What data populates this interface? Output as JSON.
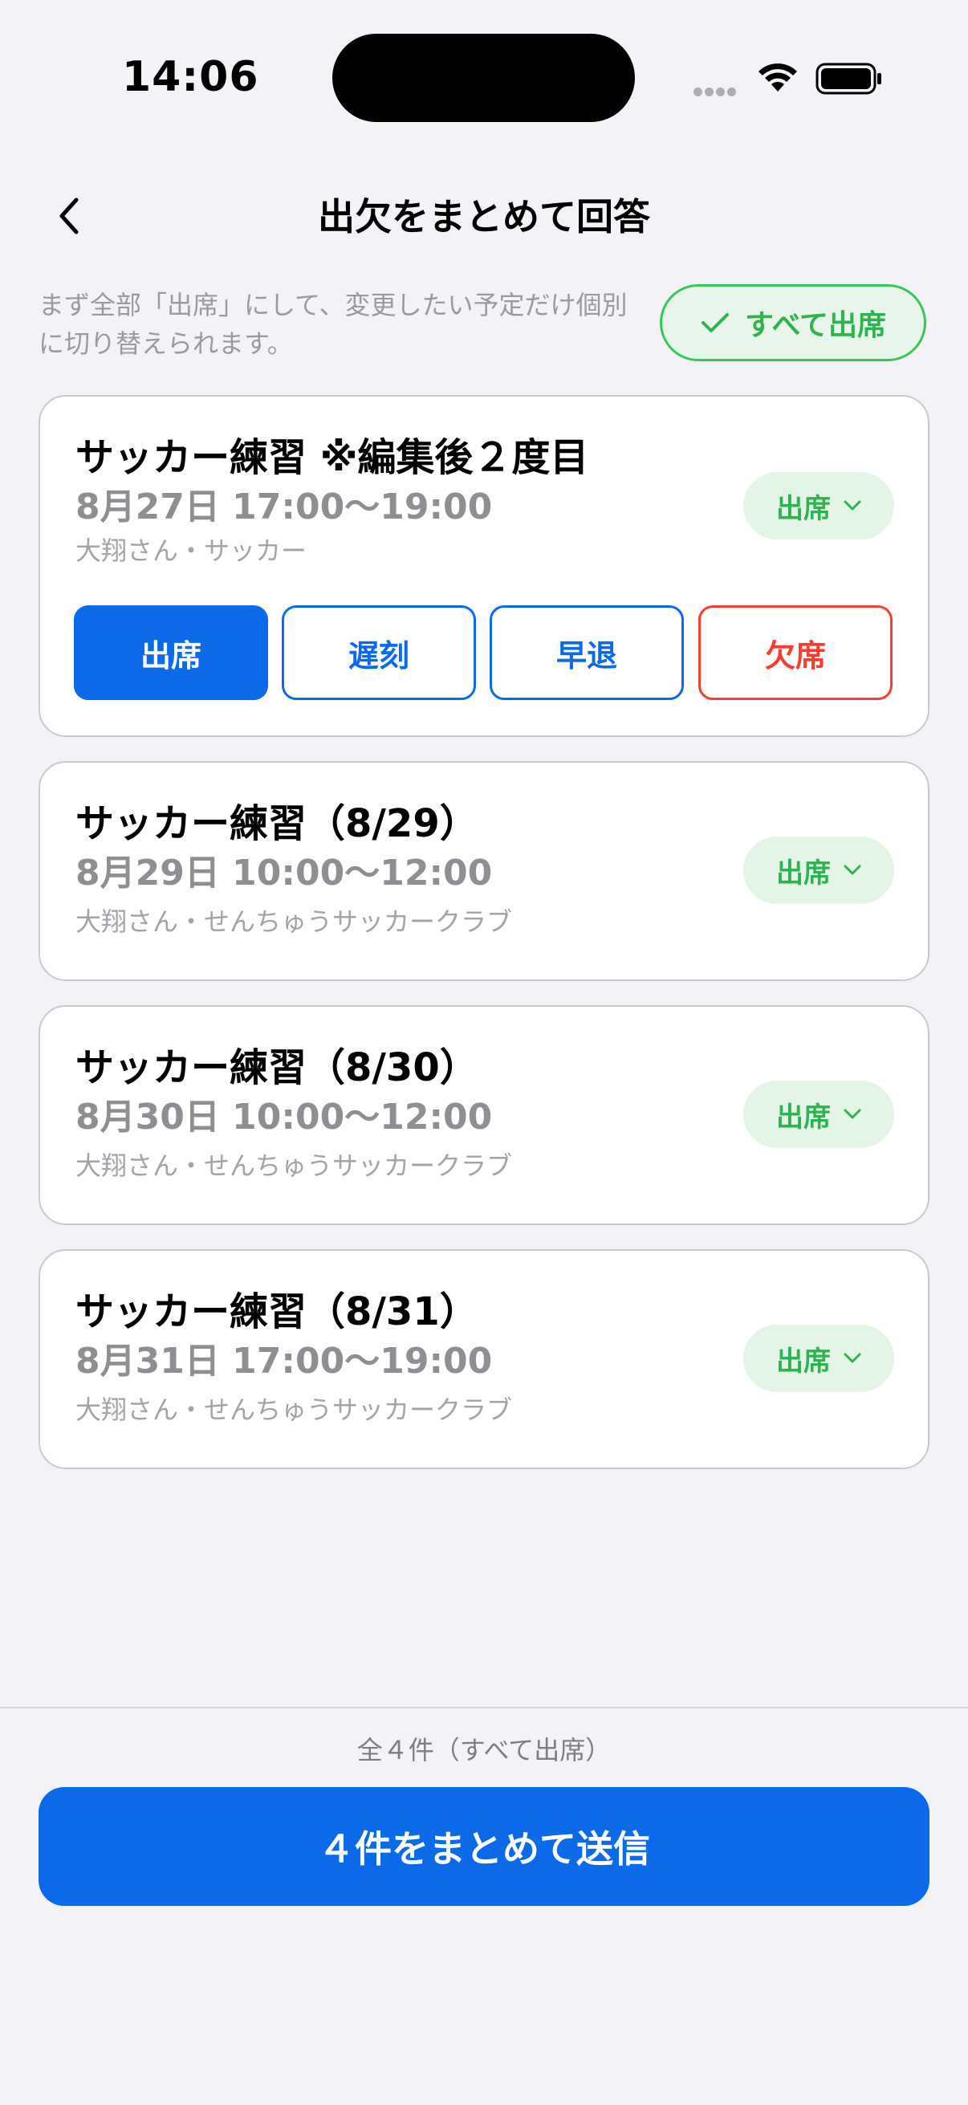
{
  "status_bar": {
    "time": "14:06"
  },
  "nav": {
    "back_icon": "chevron-left-icon",
    "title": "出欠をまとめて回答"
  },
  "helper": {
    "text": "まず全部「出席」にして、変更したい予定だけ個別に切り替えられます。",
    "all_attend_label": "すべて出席",
    "all_attend_icon": "check-icon"
  },
  "events": [
    {
      "title": "サッカー練習 ※編集後２度目",
      "date": "8月27日 17:00〜19:00",
      "subtitle": "大翔さん・サッカー",
      "status": "出席",
      "expanded": true,
      "choices": [
        {
          "label": "出席",
          "selected": true
        },
        {
          "label": "遅刻",
          "selected": false
        },
        {
          "label": "早退",
          "selected": false
        },
        {
          "label": "欠席",
          "selected": false
        }
      ]
    },
    {
      "title": "サッカー練習（8/29）",
      "date": "8月29日 10:00〜12:00",
      "subtitle": "大翔さん・せんちゅうサッカークラブ",
      "status": "出席",
      "expanded": false
    },
    {
      "title": "サッカー練習（8/30）",
      "date": "8月30日 10:00〜12:00",
      "subtitle": "大翔さん・せんちゅうサッカークラブ",
      "status": "出席",
      "expanded": false
    },
    {
      "title": "サッカー練習（8/31）",
      "date": "8月31日 17:00〜19:00",
      "subtitle": "大翔さん・せんちゅうサッカークラブ",
      "status": "出席",
      "expanded": false
    }
  ],
  "footer": {
    "count_text": "全４件（すべて出席）",
    "submit_label": "４件をまとめて送信"
  },
  "colors": {
    "primary": "#0a6ae8",
    "attend_green": "#2fb34f",
    "absent_red": "#ff3b30",
    "background": "#f2f2f7"
  }
}
